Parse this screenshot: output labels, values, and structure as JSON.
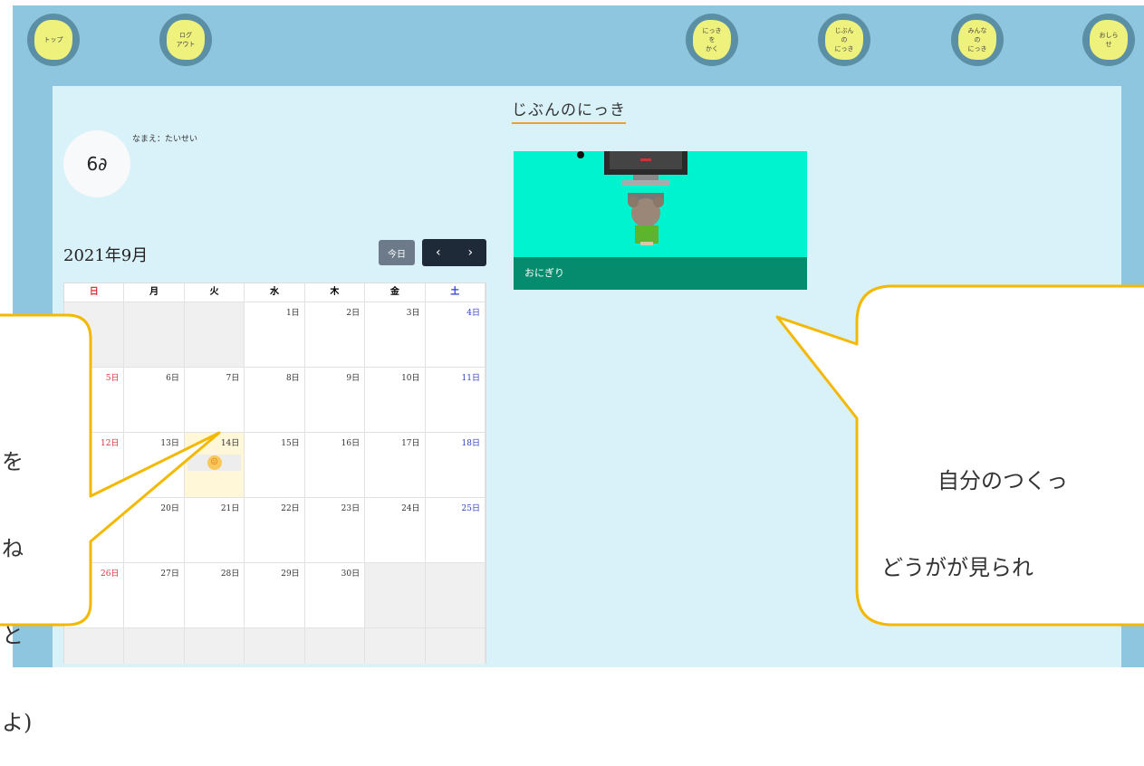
{
  "nav": {
    "top_label": "トップ",
    "logout_label": "ログ\nアウト",
    "write_label": "にっき\nを\nかく",
    "my_diary_label": "じぶん\nの\nにっき",
    "everyone_label": "みんな\nの\nにっき",
    "news_label": "おしら\nせ"
  },
  "page": {
    "title": "じぶんのにっき"
  },
  "profile": {
    "avatar_icon": "glasses-icon",
    "avatar_glyph": "6∂",
    "name_text": "なまえ：たいせい"
  },
  "calendar": {
    "month_label": "2021年9月",
    "today_label": "今日",
    "prev_glyph": "‹",
    "next_glyph": "›",
    "weekdays": [
      "日",
      "月",
      "火",
      "水",
      "木",
      "金",
      "土"
    ],
    "weeks": [
      [
        "",
        "",
        "",
        "1日",
        "2日",
        "3日",
        "4日"
      ],
      [
        "5日",
        "6日",
        "7日",
        "8日",
        "9日",
        "10日",
        "11日"
      ],
      [
        "12日",
        "13日",
        "14日",
        "15日",
        "16日",
        "17日",
        "18日"
      ],
      [
        "19日",
        "20日",
        "21日",
        "22日",
        "23日",
        "24日",
        "25日"
      ],
      [
        "26日",
        "27日",
        "28日",
        "29日",
        "30日",
        "",
        ""
      ],
      [
        "",
        "",
        "",
        "",
        "",
        "",
        ""
      ]
    ],
    "event_icon": "smiley-icon",
    "event_glyph": "☺"
  },
  "diary_card": {
    "caption": "おにぎり",
    "image_bg": "#00f3cf"
  },
  "callouts": {
    "left_lines": [
      "を",
      "ね",
      "と",
      "よ)"
    ],
    "right_lines": [
      "自分のつくっ",
      "どうがが見られ"
    ]
  },
  "colors": {
    "frame": "#8ec6df",
    "panel": "#d9f1f8",
    "bubble_border": "#f5b800",
    "nav_blob": "#eef17c",
    "nav_ring": "#5b8fa6"
  }
}
